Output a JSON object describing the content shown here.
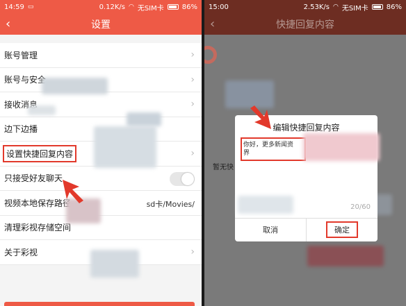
{
  "left": {
    "status": {
      "time": "14:59",
      "speed": "0.12K/s",
      "sim": "无SIM卡",
      "battery": "86%"
    },
    "nav": {
      "title": "设置",
      "back": "‹"
    },
    "items": [
      {
        "label": "账号管理"
      },
      {
        "label": "账号与安全"
      },
      {
        "label": "接收消息"
      },
      {
        "label": "边下边播"
      },
      {
        "label": "设置快捷回复内容"
      },
      {
        "label": "只接受好友聊天"
      },
      {
        "label": "视频本地保存路径",
        "value": "sd卡/Movies/"
      },
      {
        "label": "清理彩视存储空间"
      },
      {
        "label": "关于彩视"
      }
    ]
  },
  "right": {
    "status": {
      "time": "15:00",
      "speed": "2.53K/s",
      "sim": "无SIM卡",
      "battery": "86%"
    },
    "nav": {
      "title": "快捷回复内容",
      "back": "‹"
    },
    "side_text": "暂无快",
    "dialog": {
      "title": "编辑快捷回复内容",
      "input_text": "你好，更多新闻资讯关注下面资讯世界",
      "input_visible_line1": "你好，更多新闻资",
      "input_visible_line2": "界",
      "counter": "20/60",
      "cancel": "取消",
      "confirm": "确定"
    }
  },
  "colors": {
    "accent": "#ee5a46",
    "highlight": "#e2392b",
    "dark_header": "#6d2d22"
  },
  "icons": [
    "back-chevron-icon",
    "chevron-right-icon",
    "wifi-icon",
    "signal-icon",
    "battery-icon",
    "toggle-switch"
  ]
}
